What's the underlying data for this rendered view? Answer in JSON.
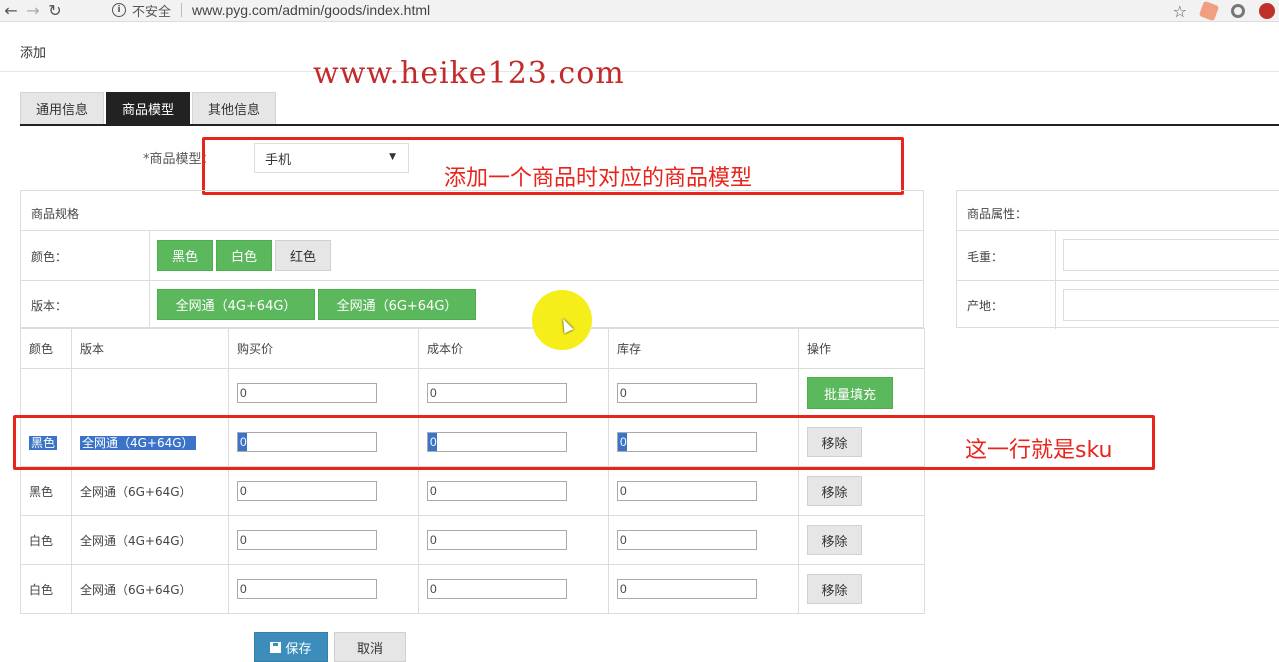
{
  "browser": {
    "insecure_label": "不安全",
    "url": "www.pyg.com/admin/goods/index.html"
  },
  "page": {
    "title": "添加",
    "watermark": "www.heike123.com"
  },
  "tabs": [
    {
      "label": "通用信息",
      "active": false
    },
    {
      "label": "商品模型",
      "active": true
    },
    {
      "label": "其他信息",
      "active": false
    }
  ],
  "model": {
    "label": "*商品模型：",
    "selected": "手机"
  },
  "annotations": {
    "model_note": "添加一个商品时对应的商品模型",
    "sku_note": "这一行就是sku"
  },
  "spec": {
    "header": "商品规格",
    "color_label": "颜色：",
    "version_label": "版本：",
    "colors": [
      {
        "label": "黑色",
        "selected": true
      },
      {
        "label": "白色",
        "selected": true
      },
      {
        "label": "红色",
        "selected": false
      }
    ],
    "versions": [
      {
        "label": "全网通（4G+64G）",
        "selected": true
      },
      {
        "label": "全网通（6G+64G）",
        "selected": true
      }
    ]
  },
  "attributes": {
    "header": "商品属性：",
    "items": [
      {
        "label": "毛重：",
        "value": ""
      },
      {
        "label": "产地：",
        "value": ""
      }
    ]
  },
  "sku_table": {
    "headers": [
      "颜色",
      "版本",
      "购买价",
      "成本价",
      "库存",
      "操作"
    ],
    "batch": {
      "price": "0",
      "cost": "0",
      "stock": "0",
      "button": "批量填充"
    },
    "rows": [
      {
        "color": "黑色",
        "version": "全网通（4G+64G）",
        "price": "0",
        "cost": "0",
        "stock": "0",
        "action": "移除"
      },
      {
        "color": "黑色",
        "version": "全网通（6G+64G）",
        "price": "0",
        "cost": "0",
        "stock": "0",
        "action": "移除"
      },
      {
        "color": "白色",
        "version": "全网通（4G+64G）",
        "price": "0",
        "cost": "0",
        "stock": "0",
        "action": "移除"
      },
      {
        "color": "白色",
        "version": "全网通（6G+64G）",
        "price": "0",
        "cost": "0",
        "stock": "0",
        "action": "移除"
      }
    ]
  },
  "footer": {
    "save": "保存",
    "cancel": "取消"
  },
  "colors": {
    "green": "#5cb85c",
    "annotation_red": "#e8241c",
    "primary_blue": "#3c8dbc"
  }
}
